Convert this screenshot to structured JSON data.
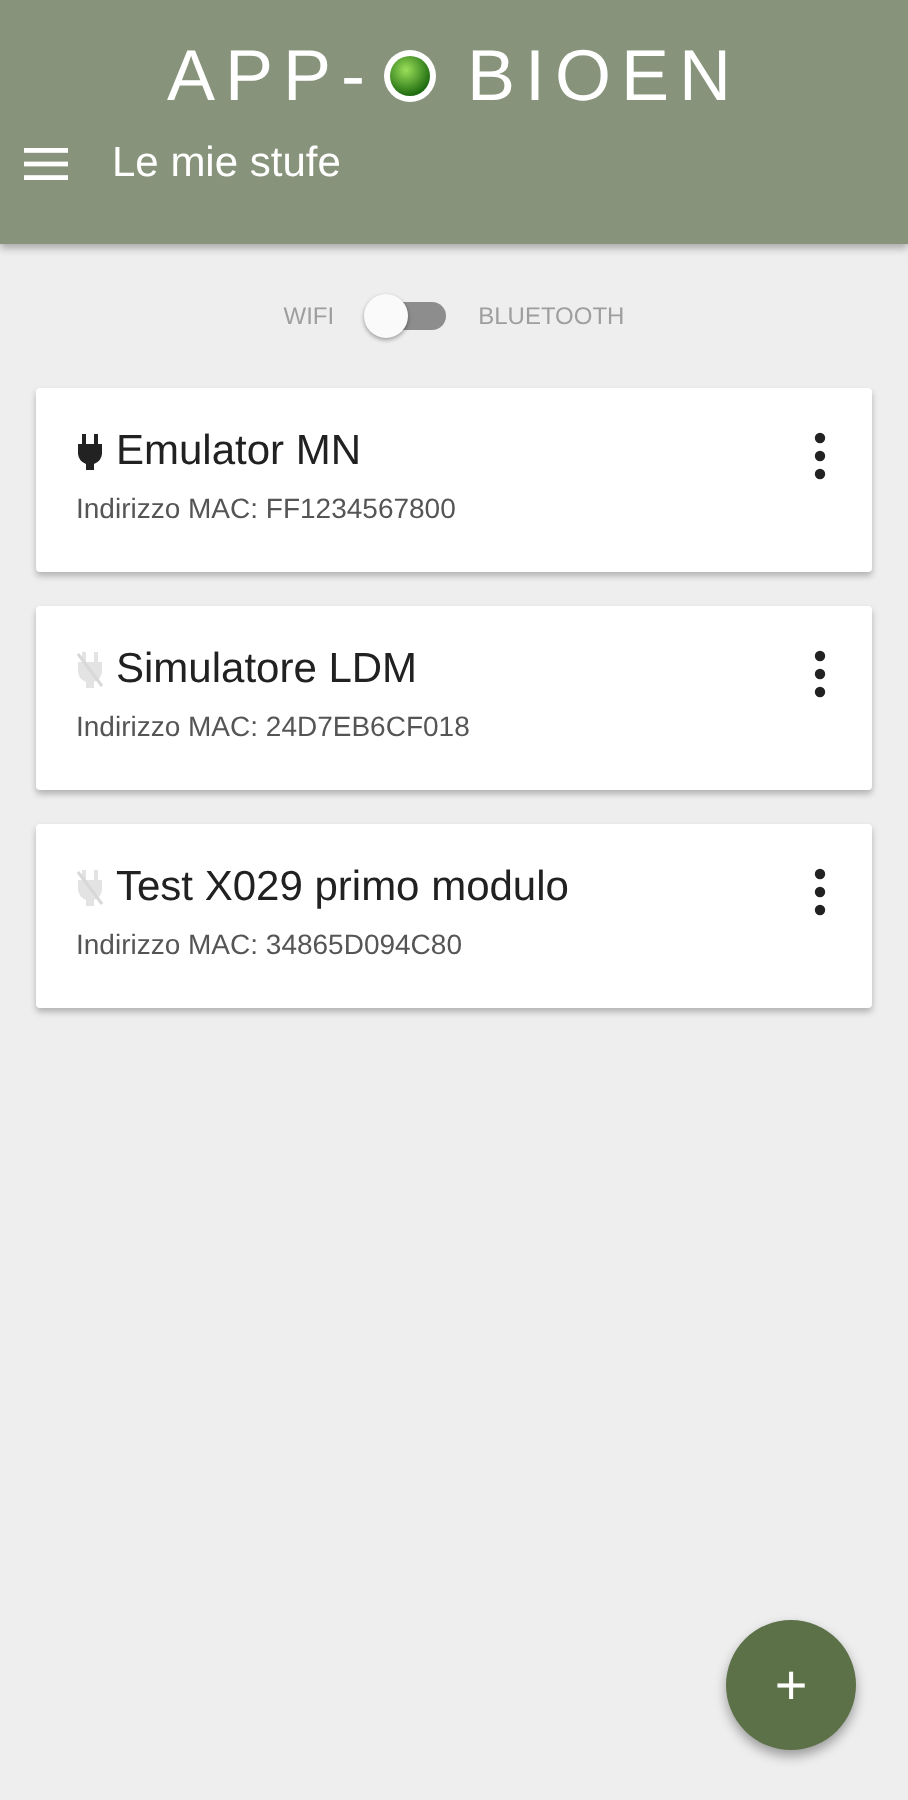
{
  "app_bar": {
    "logo_left": "APP-",
    "logo_right": "BIOEN",
    "title": "Le mie stufe"
  },
  "mode_switch": {
    "left_label": "WIFI",
    "right_label": "BLUETOOTH",
    "on": false
  },
  "devices": [
    {
      "name": "Emulator MN",
      "mac": "Indirizzo MAC: FF1234567800",
      "connected": true
    },
    {
      "name": "Simulatore LDM",
      "mac": "Indirizzo MAC: 24D7EB6CF018",
      "connected": false
    },
    {
      "name": "Test X029 primo modulo",
      "mac": "Indirizzo MAC: 34865D094C80",
      "connected": false
    }
  ],
  "fab": {
    "label": "+"
  }
}
